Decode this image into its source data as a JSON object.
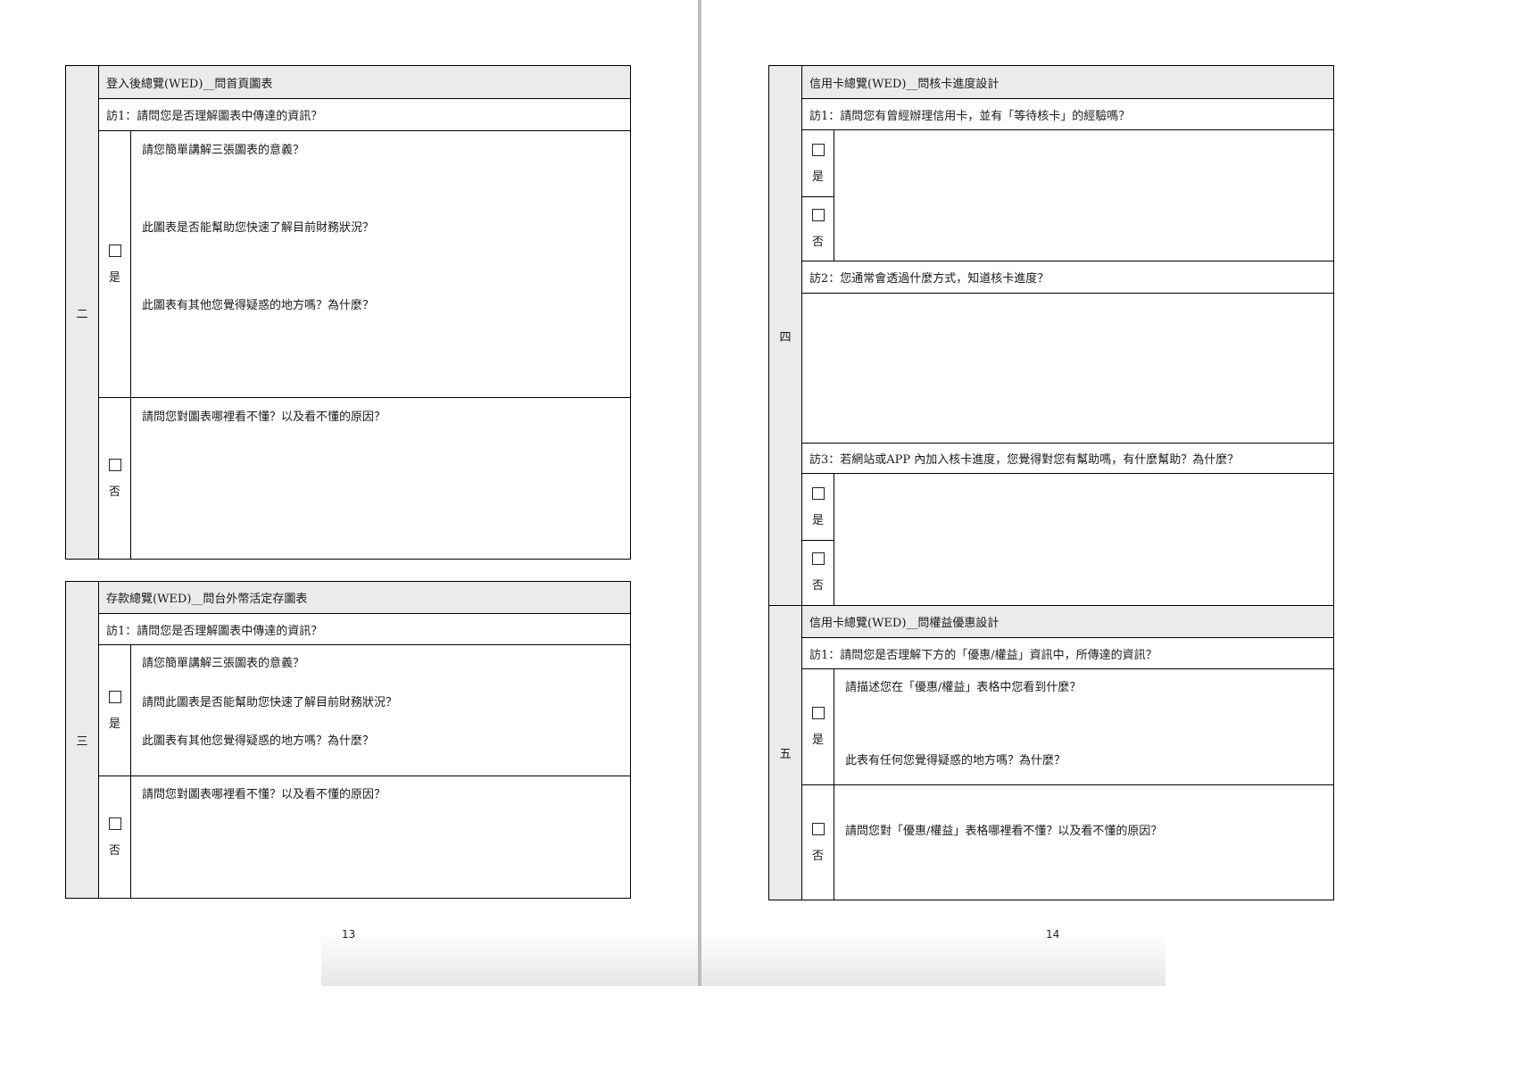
{
  "left_page": {
    "page_number": "13",
    "section_two": {
      "row_label": "二",
      "header": "登入後總覽(WED)__問首頁圖表",
      "q1": "訪1：請問您是否理解圖表中傳達的資訊？",
      "yes_label": "是",
      "no_label": "否",
      "yes_prompts": [
        "請您簡單講解三張圖表的意義？",
        "此圖表是否能幫助您快速了解目前財務狀況？",
        "此圖表有其他您覺得疑惑的地方嗎？為什麼？"
      ],
      "no_prompt": "請問您對圖表哪裡看不懂？以及看不懂的原因？"
    },
    "section_three": {
      "row_label": "三",
      "header": "存款總覽(WED)__問台外幣活定存圖表",
      "q1": "訪1：請問您是否理解圖表中傳達的資訊？",
      "yes_label": "是",
      "no_label": "否",
      "yes_prompts": [
        "請您簡單講解三張圖表的意義？",
        "請問此圖表是否能幫助您快速了解目前財務狀況？",
        "此圖表有其他您覺得疑惑的地方嗎？為什麼？"
      ],
      "no_prompt": "請問您對圖表哪裡看不懂？以及看不懂的原因？"
    }
  },
  "right_page": {
    "page_number": "14",
    "section_four": {
      "row_label": "四",
      "header": "信用卡總覽(WED)__問核卡進度設計",
      "q1": "訪1：請問您有曾經辦理信用卡，並有「等待核卡」的經驗嗎？",
      "q2": "訪2：您通常會透過什麼方式，知道核卡進度？",
      "q3": "訪3：若網站或APP 內加入核卡進度，您覺得對您有幫助嗎，有什麼幫助？為什麼？",
      "yes_label": "是",
      "no_label": "否"
    },
    "section_five": {
      "row_label": "五",
      "header": "信用卡總覽(WED)__問權益優惠設計",
      "q1": "訪1：請問您是否理解下方的「優惠/權益」資訊中，所傳達的資訊？",
      "yes_label": "是",
      "no_label": "否",
      "yes_prompts": [
        "請描述您在「優惠/權益」表格中您看到什麼？",
        "此表有任何您覺得疑惑的地方嗎？為什麼？"
      ],
      "no_prompt": "請問您對「優惠/權益」表格哪裡看不懂？以及看不懂的原因？"
    }
  }
}
